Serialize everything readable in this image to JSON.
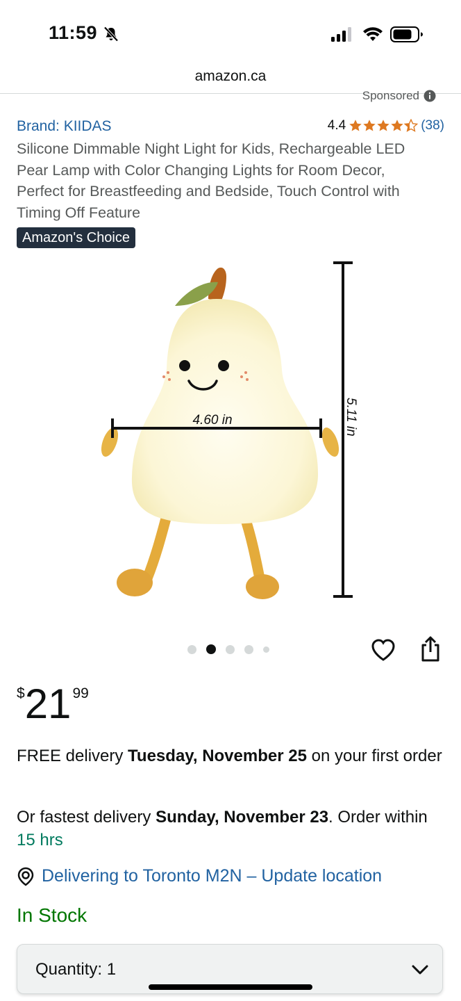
{
  "status": {
    "time": "11:59",
    "icons": [
      "bell-slash-icon",
      "cellular-signal-icon",
      "wifi-icon",
      "battery-icon"
    ]
  },
  "browser": {
    "url": "amazon.ca"
  },
  "sponsored": {
    "label": "Sponsored",
    "icon": "info-icon"
  },
  "product": {
    "brand": "Brand: KIIDAS",
    "rating": "4.4",
    "stars": 4.4,
    "review_count": "(38)",
    "title": "Silicone Dimmable Night Light for Kids, Rechargeable LED Pear Lamp with Color Changing Lights for Room Decor, Perfect for Breastfeeding and Bedside, Touch Control with Timing Off Feature",
    "badge": "Amazon's Choice",
    "image": {
      "width_label": "4.60 in",
      "height_label": "5.11 in"
    },
    "carousel": {
      "count": 5,
      "active_index": 1
    },
    "price": {
      "currency": "$",
      "whole": "21",
      "fraction": "99"
    }
  },
  "delivery": {
    "free_prefix": "FREE delivery ",
    "free_date": "Tuesday, November 25",
    "free_suffix": " on your first order",
    "fast_prefix": "Or fastest delivery ",
    "fast_date": "Sunday, November 23",
    "fast_mid": ". Order within ",
    "fast_time": "15 hrs",
    "location": "Delivering to Toronto M2N – Update location"
  },
  "stock": "In Stock",
  "quantity": {
    "label": "Quantity:",
    "value": "1"
  },
  "colors": {
    "link": "#2162a1",
    "star": "#de7921",
    "in_stock": "#007600",
    "badge_bg": "#232f3e"
  }
}
